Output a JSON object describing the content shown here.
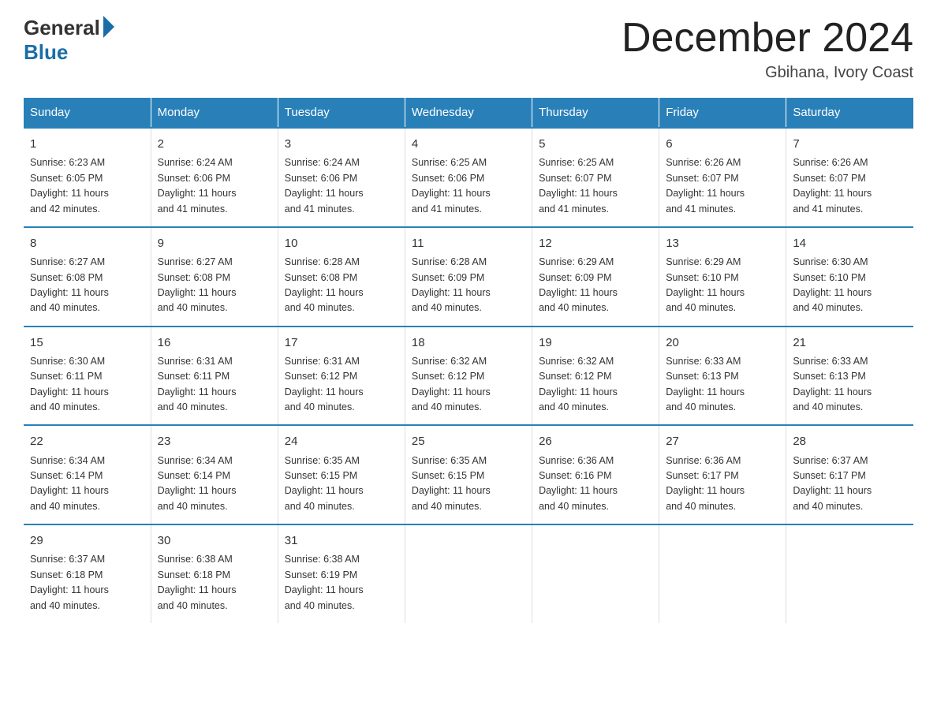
{
  "logo": {
    "general": "General",
    "blue": "Blue"
  },
  "title": "December 2024",
  "location": "Gbihana, Ivory Coast",
  "headers": [
    "Sunday",
    "Monday",
    "Tuesday",
    "Wednesday",
    "Thursday",
    "Friday",
    "Saturday"
  ],
  "weeks": [
    [
      {
        "day": "1",
        "sunrise": "6:23 AM",
        "sunset": "6:05 PM",
        "daylight": "11 hours and 42 minutes."
      },
      {
        "day": "2",
        "sunrise": "6:24 AM",
        "sunset": "6:06 PM",
        "daylight": "11 hours and 41 minutes."
      },
      {
        "day": "3",
        "sunrise": "6:24 AM",
        "sunset": "6:06 PM",
        "daylight": "11 hours and 41 minutes."
      },
      {
        "day": "4",
        "sunrise": "6:25 AM",
        "sunset": "6:06 PM",
        "daylight": "11 hours and 41 minutes."
      },
      {
        "day": "5",
        "sunrise": "6:25 AM",
        "sunset": "6:07 PM",
        "daylight": "11 hours and 41 minutes."
      },
      {
        "day": "6",
        "sunrise": "6:26 AM",
        "sunset": "6:07 PM",
        "daylight": "11 hours and 41 minutes."
      },
      {
        "day": "7",
        "sunrise": "6:26 AM",
        "sunset": "6:07 PM",
        "daylight": "11 hours and 41 minutes."
      }
    ],
    [
      {
        "day": "8",
        "sunrise": "6:27 AM",
        "sunset": "6:08 PM",
        "daylight": "11 hours and 40 minutes."
      },
      {
        "day": "9",
        "sunrise": "6:27 AM",
        "sunset": "6:08 PM",
        "daylight": "11 hours and 40 minutes."
      },
      {
        "day": "10",
        "sunrise": "6:28 AM",
        "sunset": "6:08 PM",
        "daylight": "11 hours and 40 minutes."
      },
      {
        "day": "11",
        "sunrise": "6:28 AM",
        "sunset": "6:09 PM",
        "daylight": "11 hours and 40 minutes."
      },
      {
        "day": "12",
        "sunrise": "6:29 AM",
        "sunset": "6:09 PM",
        "daylight": "11 hours and 40 minutes."
      },
      {
        "day": "13",
        "sunrise": "6:29 AM",
        "sunset": "6:10 PM",
        "daylight": "11 hours and 40 minutes."
      },
      {
        "day": "14",
        "sunrise": "6:30 AM",
        "sunset": "6:10 PM",
        "daylight": "11 hours and 40 minutes."
      }
    ],
    [
      {
        "day": "15",
        "sunrise": "6:30 AM",
        "sunset": "6:11 PM",
        "daylight": "11 hours and 40 minutes."
      },
      {
        "day": "16",
        "sunrise": "6:31 AM",
        "sunset": "6:11 PM",
        "daylight": "11 hours and 40 minutes."
      },
      {
        "day": "17",
        "sunrise": "6:31 AM",
        "sunset": "6:12 PM",
        "daylight": "11 hours and 40 minutes."
      },
      {
        "day": "18",
        "sunrise": "6:32 AM",
        "sunset": "6:12 PM",
        "daylight": "11 hours and 40 minutes."
      },
      {
        "day": "19",
        "sunrise": "6:32 AM",
        "sunset": "6:12 PM",
        "daylight": "11 hours and 40 minutes."
      },
      {
        "day": "20",
        "sunrise": "6:33 AM",
        "sunset": "6:13 PM",
        "daylight": "11 hours and 40 minutes."
      },
      {
        "day": "21",
        "sunrise": "6:33 AM",
        "sunset": "6:13 PM",
        "daylight": "11 hours and 40 minutes."
      }
    ],
    [
      {
        "day": "22",
        "sunrise": "6:34 AM",
        "sunset": "6:14 PM",
        "daylight": "11 hours and 40 minutes."
      },
      {
        "day": "23",
        "sunrise": "6:34 AM",
        "sunset": "6:14 PM",
        "daylight": "11 hours and 40 minutes."
      },
      {
        "day": "24",
        "sunrise": "6:35 AM",
        "sunset": "6:15 PM",
        "daylight": "11 hours and 40 minutes."
      },
      {
        "day": "25",
        "sunrise": "6:35 AM",
        "sunset": "6:15 PM",
        "daylight": "11 hours and 40 minutes."
      },
      {
        "day": "26",
        "sunrise": "6:36 AM",
        "sunset": "6:16 PM",
        "daylight": "11 hours and 40 minutes."
      },
      {
        "day": "27",
        "sunrise": "6:36 AM",
        "sunset": "6:17 PM",
        "daylight": "11 hours and 40 minutes."
      },
      {
        "day": "28",
        "sunrise": "6:37 AM",
        "sunset": "6:17 PM",
        "daylight": "11 hours and 40 minutes."
      }
    ],
    [
      {
        "day": "29",
        "sunrise": "6:37 AM",
        "sunset": "6:18 PM",
        "daylight": "11 hours and 40 minutes."
      },
      {
        "day": "30",
        "sunrise": "6:38 AM",
        "sunset": "6:18 PM",
        "daylight": "11 hours and 40 minutes."
      },
      {
        "day": "31",
        "sunrise": "6:38 AM",
        "sunset": "6:19 PM",
        "daylight": "11 hours and 40 minutes."
      },
      null,
      null,
      null,
      null
    ]
  ],
  "labels": {
    "sunrise": "Sunrise:",
    "sunset": "Sunset:",
    "daylight": "Daylight:"
  },
  "colors": {
    "header_bg": "#2980b9",
    "accent": "#1a6ea8"
  }
}
